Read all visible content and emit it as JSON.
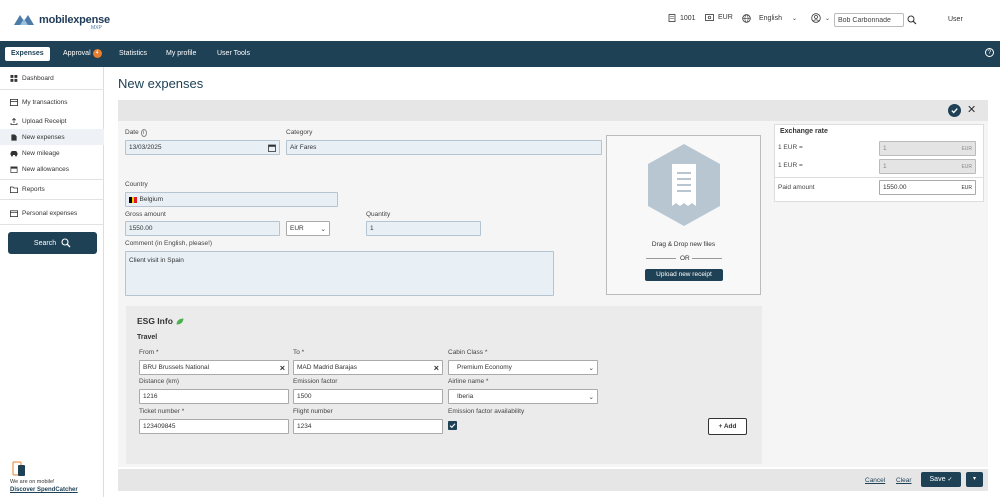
{
  "header": {
    "logo_main": "mobilexpense",
    "logo_sub": "MXP",
    "company_code": "1001",
    "currency": "EUR",
    "language": "English",
    "delegate_user": "Bob Carbonnade",
    "user_menu": "User"
  },
  "nav": {
    "expenses": "Expenses",
    "approval": "Approval",
    "approval_count": "4",
    "statistics": "Statistics",
    "my_profile": "My profile",
    "user_tools": "User Tools"
  },
  "sidebar": {
    "dashboard": "Dashboard",
    "my_transactions": "My transactions",
    "upload_receipt": "Upload Receipt",
    "new_expenses": "New expenses",
    "new_mileage": "New mileage",
    "new_allowances": "New allowances",
    "reports": "Reports",
    "personal_expenses": "Personal expenses",
    "search": "Search",
    "promo_line": "We are on mobile!",
    "promo_link": "Discover SpendCatcher"
  },
  "page": {
    "title": "New expenses"
  },
  "form": {
    "date_label": "Date",
    "date_value": "13/03/2025",
    "category_label": "Category",
    "category_value": "Air Fares",
    "country_label": "Country",
    "country_value": "Belgium",
    "gross_label": "Gross amount",
    "gross_value": "1550.00",
    "gross_currency": "EUR",
    "quantity_label": "Quantity",
    "quantity_value": "1",
    "comment_label": "Comment (in English, please!)",
    "comment_value": "Client visit in Spain"
  },
  "upload": {
    "drag_text": "Drag & Drop new files",
    "or_text": "OR",
    "button": "Upload new receipt"
  },
  "exchange": {
    "title": "Exchange rate",
    "row1_label": "1 EUR =",
    "row1_value": "1",
    "row1_unit": "EUR",
    "row2_label": "1 EUR =",
    "row2_value": "1",
    "row2_unit": "EUR",
    "paid_label": "Paid amount",
    "paid_value": "1550.00",
    "paid_unit": "EUR"
  },
  "esg": {
    "title": "ESG Info",
    "section": "Travel",
    "from_label": "From *",
    "from_value": "BRU Brussels National",
    "to_label": "To *",
    "to_value": "MAD Madrid Barajas",
    "cabin_label": "Cabin Class *",
    "cabin_value": "Premium Economy",
    "distance_label": "Distance (km)",
    "distance_value": "1216",
    "emission_label": "Emission factor",
    "emission_value": "1500",
    "airline_label": "Airline name *",
    "airline_value": "Iberia",
    "ticket_label": "Ticket number *",
    "ticket_value": "123409845",
    "flight_label": "Flight number",
    "flight_value": "1234",
    "availability_label": "Emission factor availability",
    "add_button": "+ Add"
  },
  "footer": {
    "cancel": "Cancel",
    "clear": "Clear",
    "save": "Save"
  },
  "colors": {
    "navy": "#1f4155",
    "badge": "#e87e2f",
    "input_fill": "#e8f0f6"
  }
}
